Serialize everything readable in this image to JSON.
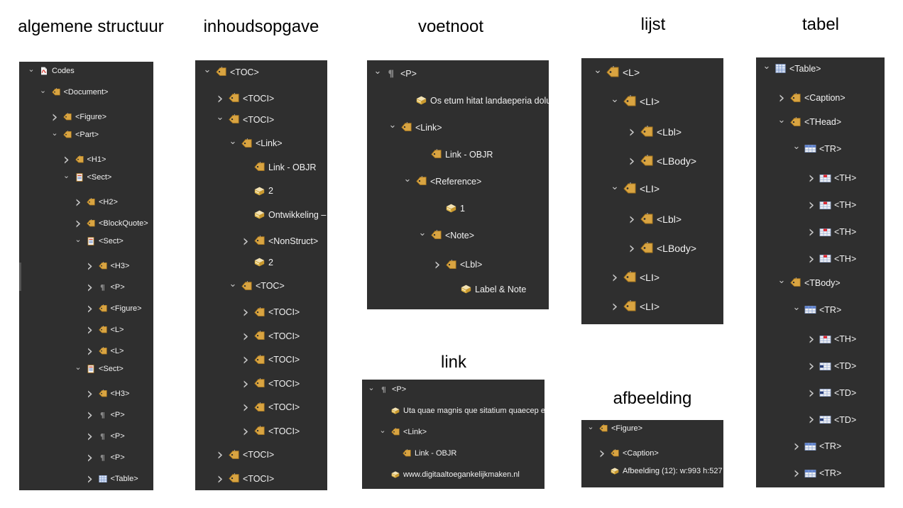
{
  "titles": {
    "algemene": "algemene structuur",
    "inhoud": "inhoudsopgave",
    "voetnoot": "voetnoot",
    "lijst": "lijst",
    "tabel": "tabel",
    "link": "link",
    "afbeelding": "afbeelding"
  },
  "colors": {
    "panel": "#2f2f2f",
    "tag": "#d9a441",
    "text": "#f2f2f2"
  },
  "algemene": [
    {
      "chev": "down",
      "icon": "pdf-icon",
      "label": "Codes"
    },
    {
      "chev": "down",
      "icon": "tag-icon",
      "label": "<Document>"
    },
    {
      "chev": "right",
      "icon": "tag-icon",
      "label": "<Figure>"
    },
    {
      "chev": "down",
      "icon": "tag-icon",
      "label": "<Part>"
    },
    {
      "chev": "right",
      "icon": "tag-icon",
      "label": "<H1>"
    },
    {
      "chev": "down",
      "icon": "sect-icon",
      "label": "<Sect>"
    },
    {
      "chev": "right",
      "icon": "tag-icon",
      "label": "<H2>"
    },
    {
      "chev": "right",
      "icon": "tag-icon",
      "label": "<BlockQuote>"
    },
    {
      "chev": "down",
      "icon": "sect-icon",
      "label": "<Sect>"
    },
    {
      "chev": "right",
      "icon": "tag-icon",
      "label": "<H3>"
    },
    {
      "chev": "right",
      "icon": "paragraph-icon",
      "label": "<P>"
    },
    {
      "chev": "right",
      "icon": "tag-icon",
      "label": "<Figure>"
    },
    {
      "chev": "right",
      "icon": "tag-icon",
      "label": "<L>"
    },
    {
      "chev": "right",
      "icon": "tag-icon",
      "label": "<L>"
    },
    {
      "chev": "down",
      "icon": "sect-icon",
      "label": "<Sect>"
    },
    {
      "chev": "right",
      "icon": "tag-icon",
      "label": "<H3>"
    },
    {
      "chev": "right",
      "icon": "paragraph-icon",
      "label": "<P>"
    },
    {
      "chev": "right",
      "icon": "paragraph-icon",
      "label": "<P>"
    },
    {
      "chev": "right",
      "icon": "paragraph-icon",
      "label": "<P>"
    },
    {
      "chev": "right",
      "icon": "table-icon",
      "label": "<Table>"
    }
  ],
  "inhoud": [
    {
      "chev": "down",
      "icon": "tag-icon",
      "label": "<TOC>"
    },
    {
      "chev": "right",
      "icon": "tag-icon",
      "label": "<TOCI>"
    },
    {
      "chev": "down",
      "icon": "tag-icon",
      "label": "<TOCI>"
    },
    {
      "chev": "down",
      "icon": "tag-icon",
      "label": "<Link>"
    },
    {
      "chev": "",
      "icon": "tag-icon",
      "label": "Link - OBJR"
    },
    {
      "chev": "",
      "icon": "content-icon",
      "label": "2"
    },
    {
      "chev": "",
      "icon": "content-icon",
      "label": "Ontwikkeling –"
    },
    {
      "chev": "right",
      "icon": "tag-icon",
      "label": "<NonStruct>"
    },
    {
      "chev": "",
      "icon": "content-icon",
      "label": "2"
    },
    {
      "chev": "down",
      "icon": "tag-icon",
      "label": "<TOC>"
    },
    {
      "chev": "right",
      "icon": "tag-icon",
      "label": "<TOCI>"
    },
    {
      "chev": "right",
      "icon": "tag-icon",
      "label": "<TOCI>"
    },
    {
      "chev": "right",
      "icon": "tag-icon",
      "label": "<TOCI>"
    },
    {
      "chev": "right",
      "icon": "tag-icon",
      "label": "<TOCI>"
    },
    {
      "chev": "right",
      "icon": "tag-icon",
      "label": "<TOCI>"
    },
    {
      "chev": "right",
      "icon": "tag-icon",
      "label": "<TOCI>"
    },
    {
      "chev": "right",
      "icon": "tag-icon",
      "label": "<TOCI>"
    },
    {
      "chev": "right",
      "icon": "tag-icon",
      "label": "<TOCI>"
    }
  ],
  "voetnoot": [
    {
      "chev": "down",
      "icon": "paragraph-icon",
      "label": "<P>"
    },
    {
      "chev": "",
      "icon": "content-icon",
      "label": "Os etum hitat landaeperia dolu"
    },
    {
      "chev": "down",
      "icon": "tag-icon",
      "label": "<Link>"
    },
    {
      "chev": "",
      "icon": "tag-icon",
      "label": "Link - OBJR"
    },
    {
      "chev": "down",
      "icon": "tag-icon",
      "label": "<Reference>"
    },
    {
      "chev": "",
      "icon": "content-icon",
      "label": "1"
    },
    {
      "chev": "down",
      "icon": "tag-icon",
      "label": "<Note>"
    },
    {
      "chev": "right",
      "icon": "tag-icon",
      "label": "<Lbl>"
    },
    {
      "chev": "",
      "icon": "content-icon",
      "label": "Label & Note"
    }
  ],
  "link": [
    {
      "chev": "down",
      "icon": "paragraph-icon",
      "label": "<P>"
    },
    {
      "chev": "",
      "icon": "content-icon",
      "label": "Uta quae magnis que sitatium quaecep ercit"
    },
    {
      "chev": "down",
      "icon": "tag-icon",
      "label": "<Link>"
    },
    {
      "chev": "",
      "icon": "tag-icon",
      "label": "Link - OBJR"
    },
    {
      "chev": "",
      "icon": "content-icon",
      "label": "www.digitaaltoegankelijkmaken.nl"
    }
  ],
  "lijst": [
    {
      "chev": "down",
      "icon": "tag-icon",
      "label": "<L>"
    },
    {
      "chev": "down",
      "icon": "tag-icon",
      "label": "<LI>"
    },
    {
      "chev": "right",
      "icon": "tag-icon",
      "label": "<Lbl>"
    },
    {
      "chev": "right",
      "icon": "tag-icon",
      "label": "<LBody>"
    },
    {
      "chev": "down",
      "icon": "tag-icon",
      "label": "<LI>"
    },
    {
      "chev": "right",
      "icon": "tag-icon",
      "label": "<Lbl>"
    },
    {
      "chev": "right",
      "icon": "tag-icon",
      "label": "<LBody>"
    },
    {
      "chev": "right",
      "icon": "tag-icon",
      "label": "<LI>"
    },
    {
      "chev": "right",
      "icon": "tag-icon",
      "label": "<LI>"
    }
  ],
  "afbeelding": [
    {
      "chev": "down",
      "icon": "tag-icon",
      "label": "<Figure>"
    },
    {
      "chev": "right",
      "icon": "tag-icon",
      "label": "<Caption>"
    },
    {
      "chev": "",
      "icon": "content-icon",
      "label": "Afbeelding (12): w:993 h:527"
    }
  ],
  "tabel": [
    {
      "chev": "down",
      "icon": "table-icon",
      "label": "<Table>"
    },
    {
      "chev": "right",
      "icon": "tag-icon",
      "label": "<Caption>"
    },
    {
      "chev": "down",
      "icon": "tag-icon",
      "label": "<THead>"
    },
    {
      "chev": "down",
      "icon": "tr-icon",
      "label": "<TR>"
    },
    {
      "chev": "right",
      "icon": "th-icon",
      "label": "<TH>"
    },
    {
      "chev": "right",
      "icon": "th-icon",
      "label": "<TH>"
    },
    {
      "chev": "right",
      "icon": "th-icon",
      "label": "<TH>"
    },
    {
      "chev": "right",
      "icon": "th-icon",
      "label": "<TH>"
    },
    {
      "chev": "down",
      "icon": "tag-icon",
      "label": "<TBody>"
    },
    {
      "chev": "down",
      "icon": "tr-icon",
      "label": "<TR>"
    },
    {
      "chev": "right",
      "icon": "th-icon",
      "label": "<TH>"
    },
    {
      "chev": "right",
      "icon": "td-icon",
      "label": "<TD>"
    },
    {
      "chev": "right",
      "icon": "td-icon",
      "label": "<TD>"
    },
    {
      "chev": "right",
      "icon": "td-icon",
      "label": "<TD>"
    },
    {
      "chev": "right",
      "icon": "tr-icon",
      "label": "<TR>"
    },
    {
      "chev": "right",
      "icon": "tr-icon",
      "label": "<TR>"
    }
  ]
}
